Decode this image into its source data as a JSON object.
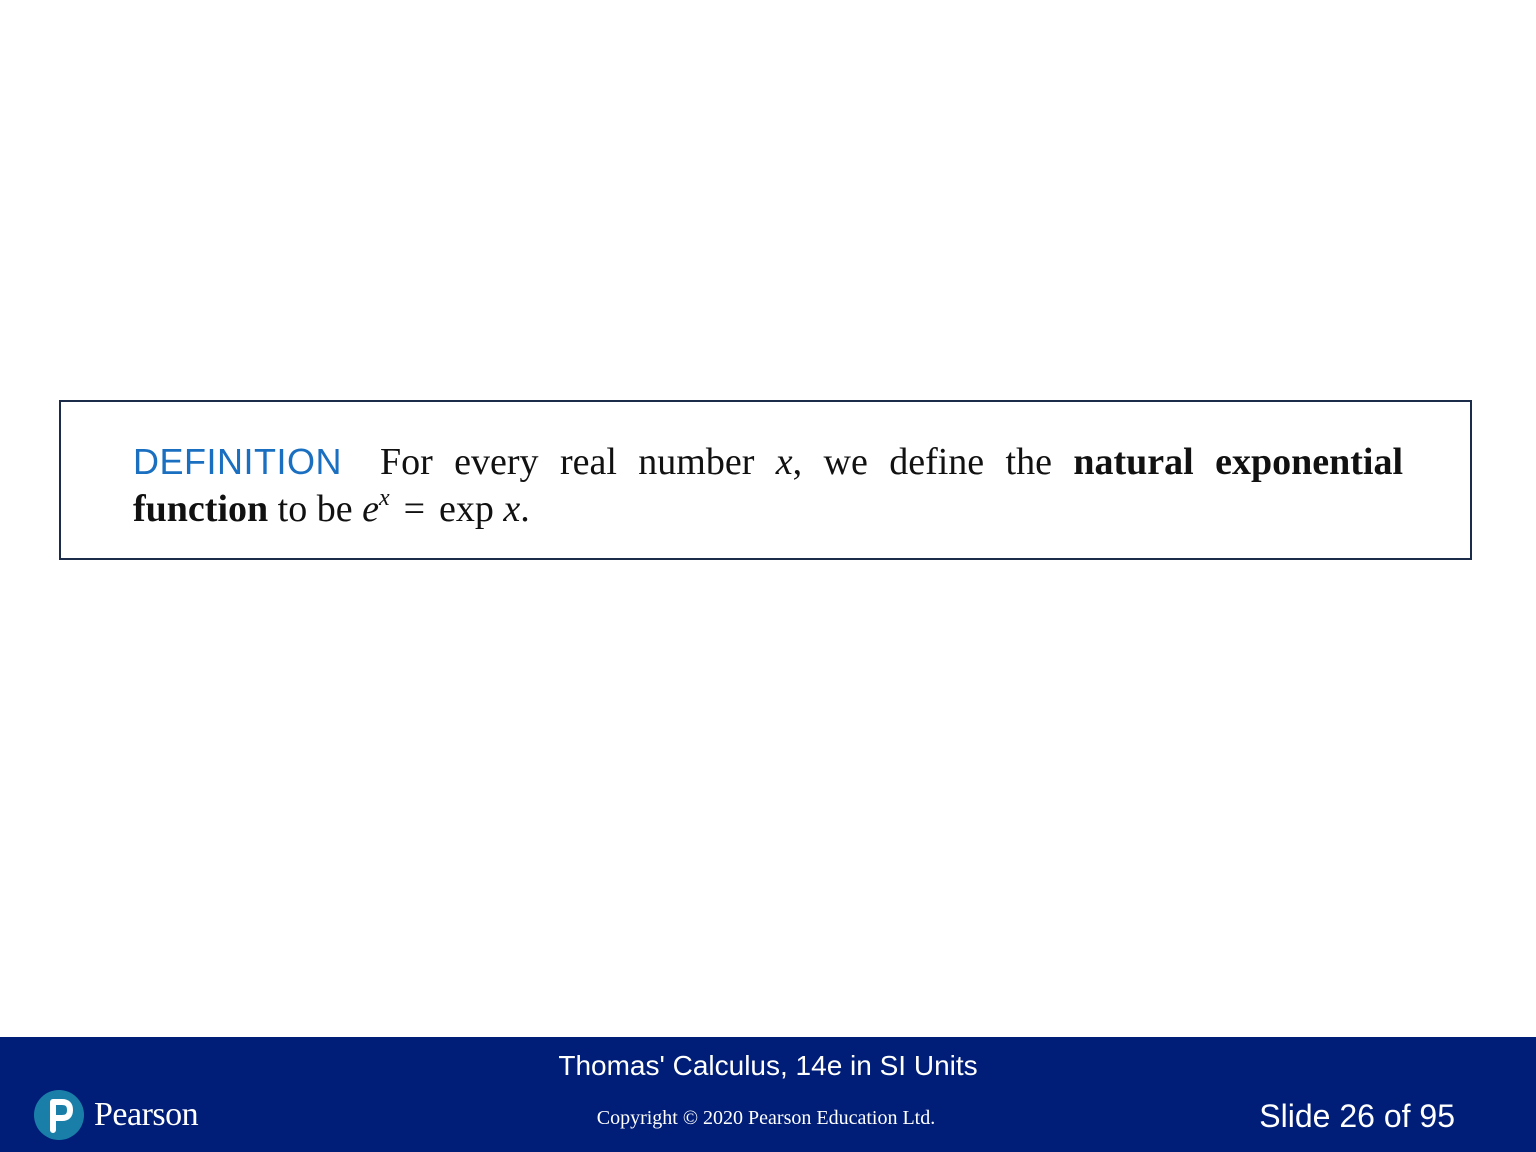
{
  "definition": {
    "label": "DEFINITION",
    "line1_text": "For every real number",
    "var_x": "x",
    "line1_after_x": ", we define the",
    "bold_term_part1": "natural exponential",
    "bold_term_part2": "function",
    "line2_text": "to be",
    "base_e": "e",
    "exponent_x": "x",
    "equals": "=",
    "exp_text": "exp",
    "period": "."
  },
  "footer": {
    "book_title": "Thomas' Calculus, 14e in SI Units",
    "copyright": "Copyright © 2020 Pearson Education Ltd.",
    "slide_number": "Slide 26 of 95",
    "logo_text": "Pearson",
    "colors": {
      "background": "#001e78",
      "logo_mark": "#1a7fa8"
    }
  },
  "colors": {
    "definition_label": "#1a6fc0",
    "box_border": "#1b2c4a"
  }
}
